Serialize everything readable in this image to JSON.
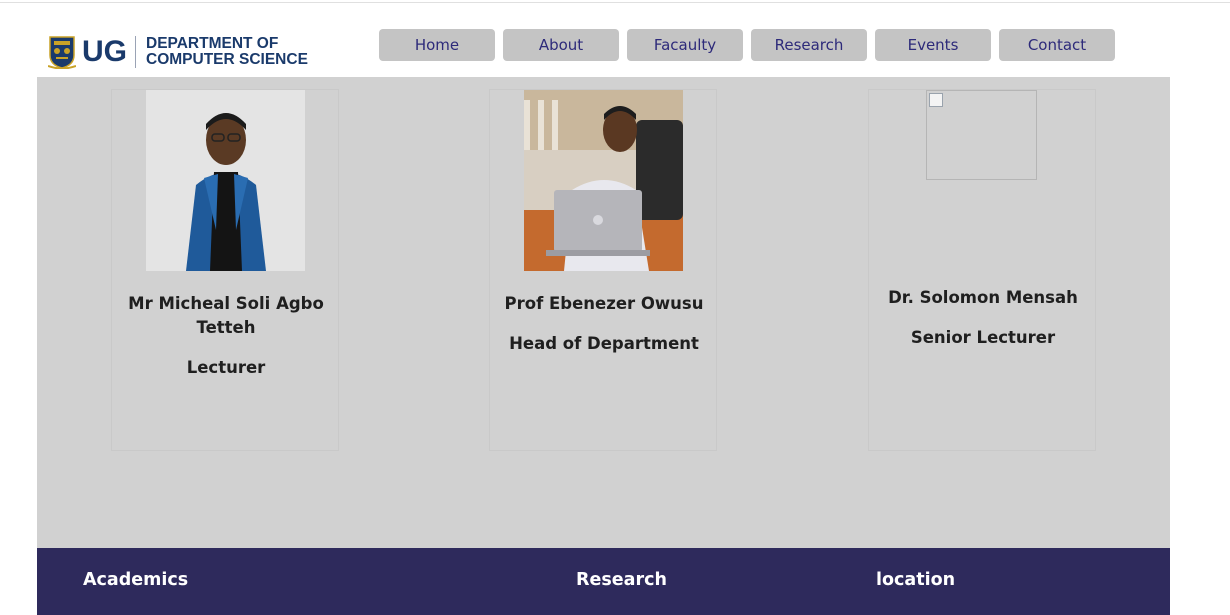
{
  "header": {
    "logo_short": "UG",
    "logo_line1": "DEPARTMENT OF",
    "logo_line2": "COMPUTER SCIENCE"
  },
  "nav": {
    "items": [
      {
        "label": "Home"
      },
      {
        "label": "About"
      },
      {
        "label": "Facaulty"
      },
      {
        "label": "Research"
      },
      {
        "label": "Events"
      },
      {
        "label": "Contact"
      }
    ]
  },
  "faculty": [
    {
      "name": "Mr Micheal Soli Agbo Tetteh",
      "role": "Lecturer"
    },
    {
      "name": "Prof Ebenezer Owusu",
      "role": "Head of Department"
    },
    {
      "name": "Dr. Solomon Mensah",
      "role": "Senior Lecturer"
    }
  ],
  "footer": {
    "headings": [
      "Academics",
      "Research",
      "location"
    ]
  },
  "colors": {
    "brand_blue": "#1a3a6b",
    "nav_bg": "#c4c4c4",
    "nav_text": "#2d2a7a",
    "main_bg": "#d1d1d1",
    "footer_bg": "#2e2a5c"
  }
}
